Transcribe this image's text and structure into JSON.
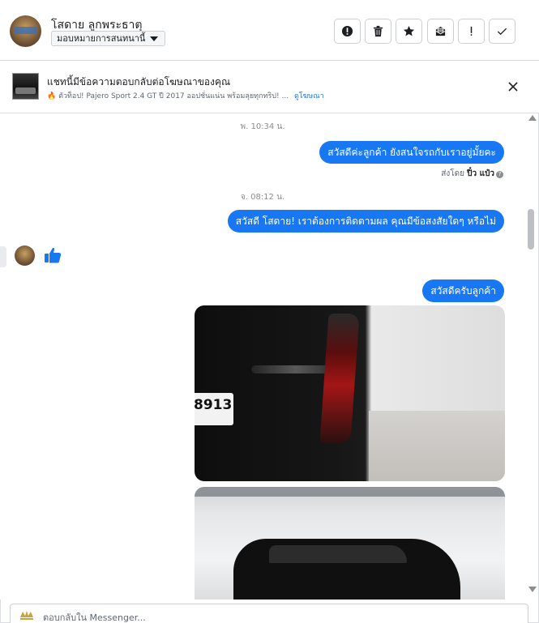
{
  "header": {
    "contact_name": "โสดาย ลูกพระธาตุ",
    "assign_label": "มอบหมายการสนทนานี้",
    "actions": [
      {
        "name": "report-spam",
        "icon": "alert-circle-icon"
      },
      {
        "name": "delete",
        "icon": "trash-icon"
      },
      {
        "name": "star",
        "icon": "star-icon"
      },
      {
        "name": "mark-unread",
        "icon": "envelope-icon"
      },
      {
        "name": "follow-up",
        "icon": "exclamation-icon"
      },
      {
        "name": "mark-done",
        "icon": "check-icon"
      }
    ]
  },
  "ad_banner": {
    "title": "แชทนี้มีข้อความตอบกลับต่อโฆษณาของคุณ",
    "subtitle": "ตัวท็อป! Pajero Sport 2.4 GT ปี 2017 ออปชั่นแน่น พร้อมลุยทุกทริป! ...",
    "link_label": "ดูโฆษณา"
  },
  "conversation": {
    "timestamp_1": "พ. 10:34 น.",
    "message_1": "สวัสดีค่ะลูกค้า ยังสนใจรถกับเราอยู่มั้ยคะ",
    "sent_by_prefix": "ส่งโดย",
    "sent_by_name": "ปิ๋ว แป๋ว",
    "timestamp_2": "จ. 08:12 น.",
    "message_2": "สวัสดี โสดาย! เราต้องการติดตามผล คุณมีข้อสงสัยใดๆ หรือไม่",
    "incoming_reaction": "thumbs-up-icon",
    "message_3": "สวัสดีครับลูกค้า",
    "photo_1_plate_text": "8913"
  },
  "composer": {
    "placeholder": "ตอบกลับใน Messenger..."
  },
  "colors": {
    "bubble_blue": "#1877f2",
    "border": "#dadde1"
  }
}
